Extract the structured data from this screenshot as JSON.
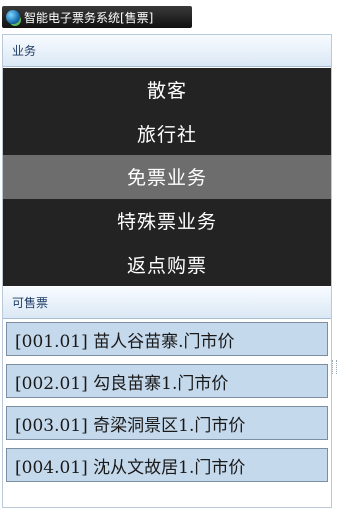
{
  "window": {
    "title": "智能电子票务系统[售票]",
    "icon": "app-globe-icon"
  },
  "business": {
    "header": "业务",
    "items": [
      {
        "label": "散客",
        "active": false
      },
      {
        "label": "旅行社",
        "active": false
      },
      {
        "label": "免票业务",
        "active": true
      },
      {
        "label": "特殊票业务",
        "active": false
      },
      {
        "label": "返点购票",
        "active": false
      }
    ]
  },
  "sellable": {
    "header": "可售票",
    "tickets": [
      "[001.01] 苗人谷苗寨.门市价",
      "[002.01] 勾良苗寨1.门市价",
      "[003.01] 奇梁洞景区1.门市价",
      "[004.01] 沈从文故居1.门市价"
    ]
  },
  "colors": {
    "menu_bg": "#232323",
    "menu_active": "#6d6d6d",
    "ticket_bg": "#c5d9ec",
    "header_text": "#1f3b64"
  }
}
